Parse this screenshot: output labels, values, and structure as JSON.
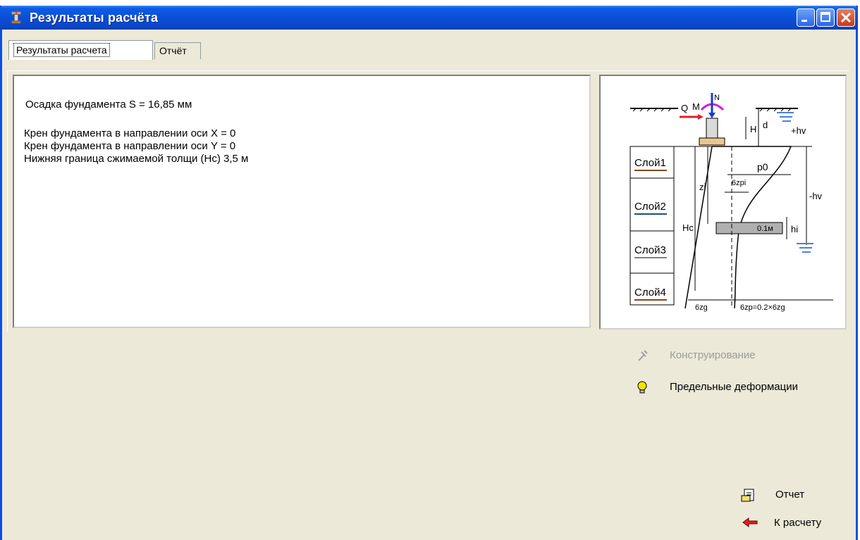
{
  "window": {
    "title": "Результаты расчёта"
  },
  "tabs": [
    {
      "label": "Результаты расчета",
      "active": true
    },
    {
      "label": "Отчёт",
      "active": false
    }
  ],
  "results": {
    "settlement": "Осадка фундамента S = 16,85 мм",
    "tilt_x": "Крен фундамента в направлении оси X = 0",
    "tilt_y": "Крен фундамента в направлении оси Y = 0",
    "lower_bound": "Нижняя граница сжимаемой толщи (Hc) 3,5 м"
  },
  "diagram": {
    "layers": [
      "Слой1",
      "Слой2",
      "Слой3",
      "Слой4"
    ],
    "layer_colors": [
      "#8b4513",
      "#1f4e79",
      "#808080",
      "#8b4513"
    ],
    "labels": {
      "q": "Q",
      "m": "M",
      "n": "N",
      "h": "H",
      "d": "d",
      "hv_plus": "+hv",
      "hv_minus": "-hv",
      "p0": "p0",
      "zi": "zi",
      "hc": "Hc",
      "szpi": "6zpi",
      "hi": "hi",
      "layer_thickness": "0.1м",
      "szg": "6zg",
      "szp": "6zp=0.2×6zg"
    }
  },
  "actions": {
    "design": {
      "label": "Конструирование",
      "icon": "tools-icon",
      "enabled": false
    },
    "limit": {
      "label": "Предельные деформации",
      "icon": "bulb-icon",
      "enabled": true
    },
    "report": {
      "label": "Отчет",
      "icon": "report-icon",
      "enabled": true
    },
    "back": {
      "label": "К расчету",
      "icon": "arrow-left-icon",
      "enabled": true
    }
  }
}
